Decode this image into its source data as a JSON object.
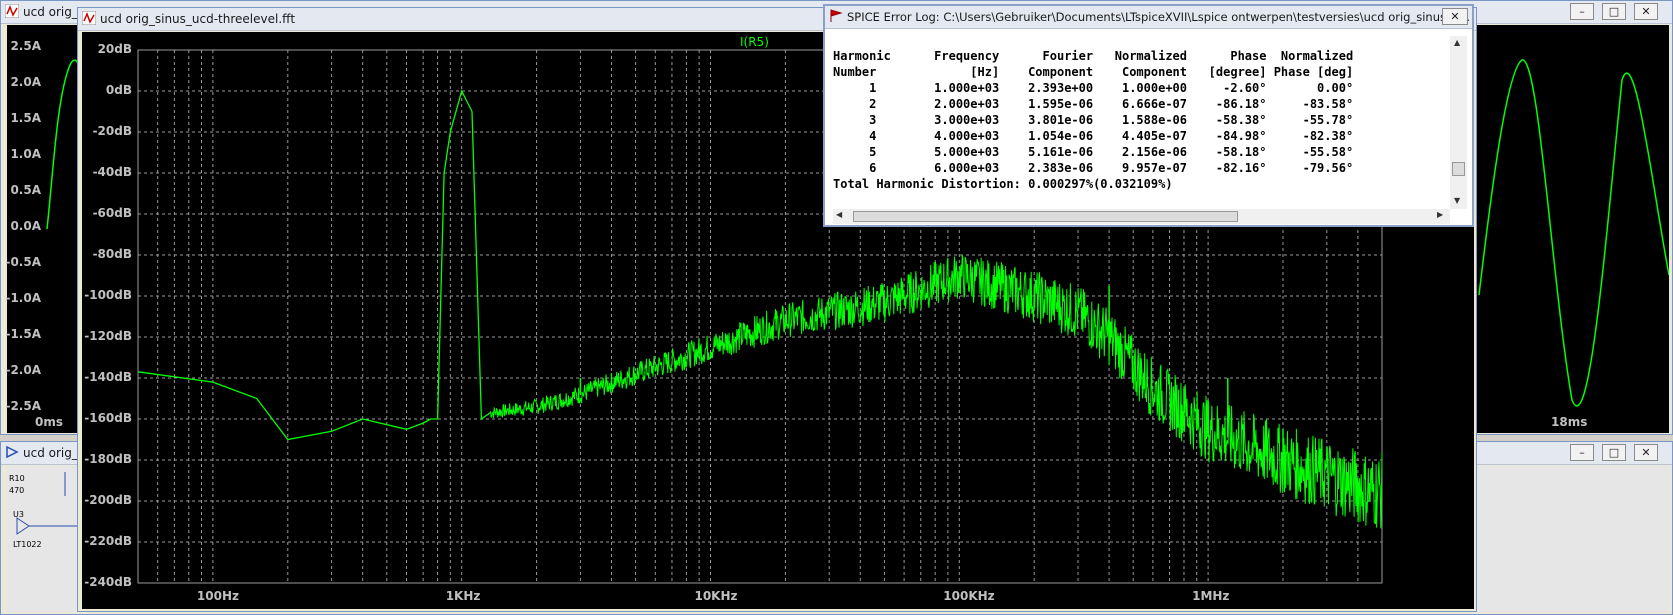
{
  "colors": {
    "trace": "#00ff00",
    "grid": "#9a9a9a",
    "plot_bg": "#000000",
    "axis_text": "#c0c0c0"
  },
  "bg_window": {
    "title": "ucd orig_",
    "y_ticks": [
      "2.5A",
      "2.0A",
      "1.5A",
      "1.0A",
      "0.5A",
      "0.0A",
      "-0.5A",
      "-1.0A",
      "-1.5A",
      "-2.0A",
      "-2.5A"
    ],
    "x_ticks_visible": [
      "0ms",
      "18ms"
    ]
  },
  "schematic_window": {
    "title": "ucd orig_",
    "labels": [
      "R10",
      "470",
      "U3",
      "LT1022"
    ]
  },
  "fft_window": {
    "title": "ucd orig_sinus_ucd-threelevel.fft",
    "trace_label": "I(R5)",
    "y_ticks": [
      "20dB",
      "0dB",
      "-20dB",
      "-40dB",
      "-60dB",
      "-80dB",
      "-100dB",
      "-120dB",
      "-140dB",
      "-160dB",
      "-180dB",
      "-200dB",
      "-220dB",
      "-240dB"
    ],
    "x_ticks": [
      "100Hz",
      "1KHz",
      "10KHz",
      "100KHz",
      "1MHz"
    ]
  },
  "chart_data": {
    "type": "line",
    "title": "I(R5)",
    "xscale": "log",
    "xlim": [
      50,
      5000000
    ],
    "ylim": [
      -240,
      20
    ],
    "xlabel": "",
    "ylabel": "",
    "grid": true,
    "series": [
      {
        "name": "I(R5)",
        "x": [
          50,
          100,
          150,
          200,
          300,
          400,
          600,
          700,
          750,
          800,
          850,
          900,
          1000,
          1100,
          1200,
          1300,
          1500,
          2000,
          3000,
          5000,
          10000,
          20000,
          50000,
          100000,
          200000,
          300000,
          400000,
          600000,
          1000000,
          2000000,
          4500000
        ],
        "y": [
          -137,
          -142,
          -150,
          -170,
          -166,
          -160,
          -165,
          -162,
          -160,
          -160,
          -40,
          -20,
          0,
          -10,
          -160,
          -157,
          -156,
          -154,
          -148,
          -138,
          -125,
          -112,
          -103,
          -90,
          -100,
          -108,
          -120,
          -145,
          -165,
          -180,
          -195
        ]
      }
    ],
    "spikes": [
      {
        "x": 3000,
        "y": -140
      },
      {
        "x": 5000,
        "y": -138
      },
      {
        "x": 400000,
        "y": -95
      },
      {
        "x": 800000,
        "y": -145
      },
      {
        "x": 1200000,
        "y": -140
      },
      {
        "x": 2000000,
        "y": -165
      }
    ]
  },
  "error_log": {
    "title": "SPICE Error Log: C:\\Users\\Gebruiker\\Documents\\LTspiceXVII\\Lspice ontwerpen\\testversies\\ucd orig_sinus_u...",
    "header1": [
      "Harmonic",
      "Frequency",
      "Fourier",
      "Normalized",
      "Phase",
      "Normalized"
    ],
    "header2": [
      "Number",
      "[Hz]",
      "Component",
      "Component",
      "[degree]",
      "Phase [deg]"
    ],
    "rows": [
      [
        "1",
        "1.000e+03",
        "2.393e+00",
        "1.000e+00",
        "-2.60°",
        "0.00°"
      ],
      [
        "2",
        "2.000e+03",
        "1.595e-06",
        "6.666e-07",
        "-86.18°",
        "-83.58°"
      ],
      [
        "3",
        "3.000e+03",
        "3.801e-06",
        "1.588e-06",
        "-58.38°",
        "-55.78°"
      ],
      [
        "4",
        "4.000e+03",
        "1.054e-06",
        "4.405e-07",
        "-84.98°",
        "-82.38°"
      ],
      [
        "5",
        "5.000e+03",
        "5.161e-06",
        "2.156e-06",
        "-58.18°",
        "-55.58°"
      ],
      [
        "6",
        "6.000e+03",
        "2.383e-06",
        "9.957e-07",
        "-82.16°",
        "-79.56°"
      ]
    ],
    "thd": "Total Harmonic Distortion: 0.000297%(0.032109%)"
  },
  "controls": {
    "minimize": "–",
    "maximize": "□",
    "close": "✕"
  }
}
